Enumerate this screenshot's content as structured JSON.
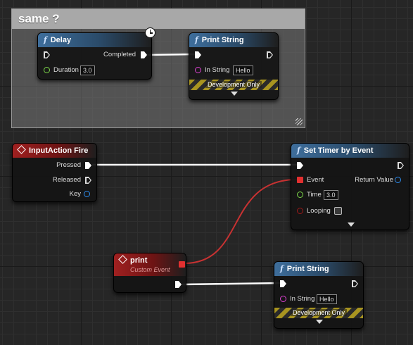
{
  "comment": {
    "title": "same ?"
  },
  "delay_node": {
    "icon": "function-icon",
    "title": "Delay",
    "completed_label": "Completed",
    "duration_label": "Duration",
    "duration_value": "3.0"
  },
  "print_string_top": {
    "icon": "function-icon",
    "title": "Print String",
    "in_string_label": "In String",
    "in_string_value": "Hello",
    "dev_only": "Development Only"
  },
  "input_action_node": {
    "icon": "event-icon",
    "title": "InputAction Fire",
    "pressed_label": "Pressed",
    "released_label": "Released",
    "key_label": "Key"
  },
  "set_timer_node": {
    "icon": "function-icon",
    "title": "Set Timer by Event",
    "event_label": "Event",
    "return_label": "Return Value",
    "time_label": "Time",
    "time_value": "3.0",
    "looping_label": "Looping"
  },
  "custom_event_node": {
    "icon": "event-icon",
    "title": "print",
    "subtitle": "Custom Event"
  },
  "print_string_bottom": {
    "icon": "function-icon",
    "title": "Print String",
    "in_string_label": "In String",
    "in_string_value": "Hello",
    "dev_only": "Development Only"
  },
  "colors": {
    "function_header": "#3e6e9c",
    "event_header": "#a02020",
    "exec_wire": "#ffffff",
    "delegate_wire": "#c83232",
    "float_pin": "#7dd94a",
    "string_pin": "#e042d6",
    "bool_pin": "#a01818",
    "struct_pin": "#2e8ef0"
  }
}
